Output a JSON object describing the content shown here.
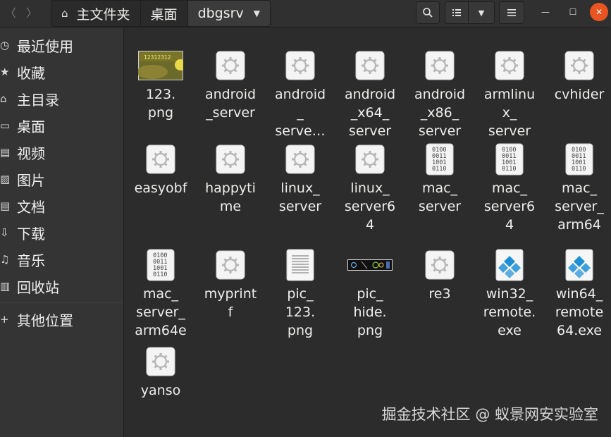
{
  "header": {
    "back_glyph": "〈",
    "forward_glyph": "〉",
    "path": [
      "主文件夹",
      "桌面",
      "dbgsrv"
    ],
    "home_icon": "home-icon",
    "search_icon": "search-icon",
    "list_view_icon": "list-view-icon",
    "sort_icon": "chevron-down-icon",
    "menu_icon": "hamburger-menu-icon",
    "minimize_glyph": "—",
    "maximize_glyph": "☐",
    "close_glyph": "✕",
    "accent": "#e95420"
  },
  "sidebar": {
    "items": [
      {
        "label": "最近使用",
        "icon": "clock-icon"
      },
      {
        "label": "收藏",
        "icon": "star-icon"
      },
      {
        "label": "主目录",
        "icon": "home-icon"
      },
      {
        "label": "桌面",
        "icon": "desktop-icon"
      },
      {
        "label": "视频",
        "icon": "film-icon"
      },
      {
        "label": "图片",
        "icon": "image-icon"
      },
      {
        "label": "文档",
        "icon": "document-icon"
      },
      {
        "label": "下载",
        "icon": "download-icon"
      },
      {
        "label": "音乐",
        "icon": "music-icon"
      },
      {
        "label": "回收站",
        "icon": "trash-icon"
      },
      {
        "label": "其他位置",
        "icon": "plus-icon"
      }
    ]
  },
  "files": [
    {
      "label": "123.\npng",
      "type": "image-thumb"
    },
    {
      "label": "android\n_server",
      "type": "exec"
    },
    {
      "label": "android\n_\nserve…",
      "type": "exec"
    },
    {
      "label": "android\n_x64_\nserver",
      "type": "exec"
    },
    {
      "label": "android\n_x86_\nserver",
      "type": "exec"
    },
    {
      "label": "armlinu\nx_\nserver",
      "type": "exec"
    },
    {
      "label": "cvhider",
      "type": "exec"
    },
    {
      "label": "easyobf",
      "type": "exec"
    },
    {
      "label": "happyti\nme",
      "type": "exec"
    },
    {
      "label": "linux_\nserver",
      "type": "exec"
    },
    {
      "label": "linux_\nserver6\n4",
      "type": "exec"
    },
    {
      "label": "mac_\nserver",
      "type": "binary"
    },
    {
      "label": "mac_\nserver6\n4",
      "type": "binary"
    },
    {
      "label": "mac_\nserver_\narm64",
      "type": "binary"
    },
    {
      "label": "mac_\nserver_\narm64e",
      "type": "binary"
    },
    {
      "label": "myprint\nf",
      "type": "exec"
    },
    {
      "label": "pic_\n123.\npng",
      "type": "text"
    },
    {
      "label": "pic_\nhide.\npng",
      "type": "image-strip"
    },
    {
      "label": "re3",
      "type": "exec"
    },
    {
      "label": "win32_\nremote.\nexe",
      "type": "winexe"
    },
    {
      "label": "win64_\nremote\n64.exe",
      "type": "winexe"
    },
    {
      "label": "yanso",
      "type": "exec"
    }
  ],
  "thumb_text": "12312312",
  "watermark": "掘金技术社区 @ 蚁景网安实验室"
}
